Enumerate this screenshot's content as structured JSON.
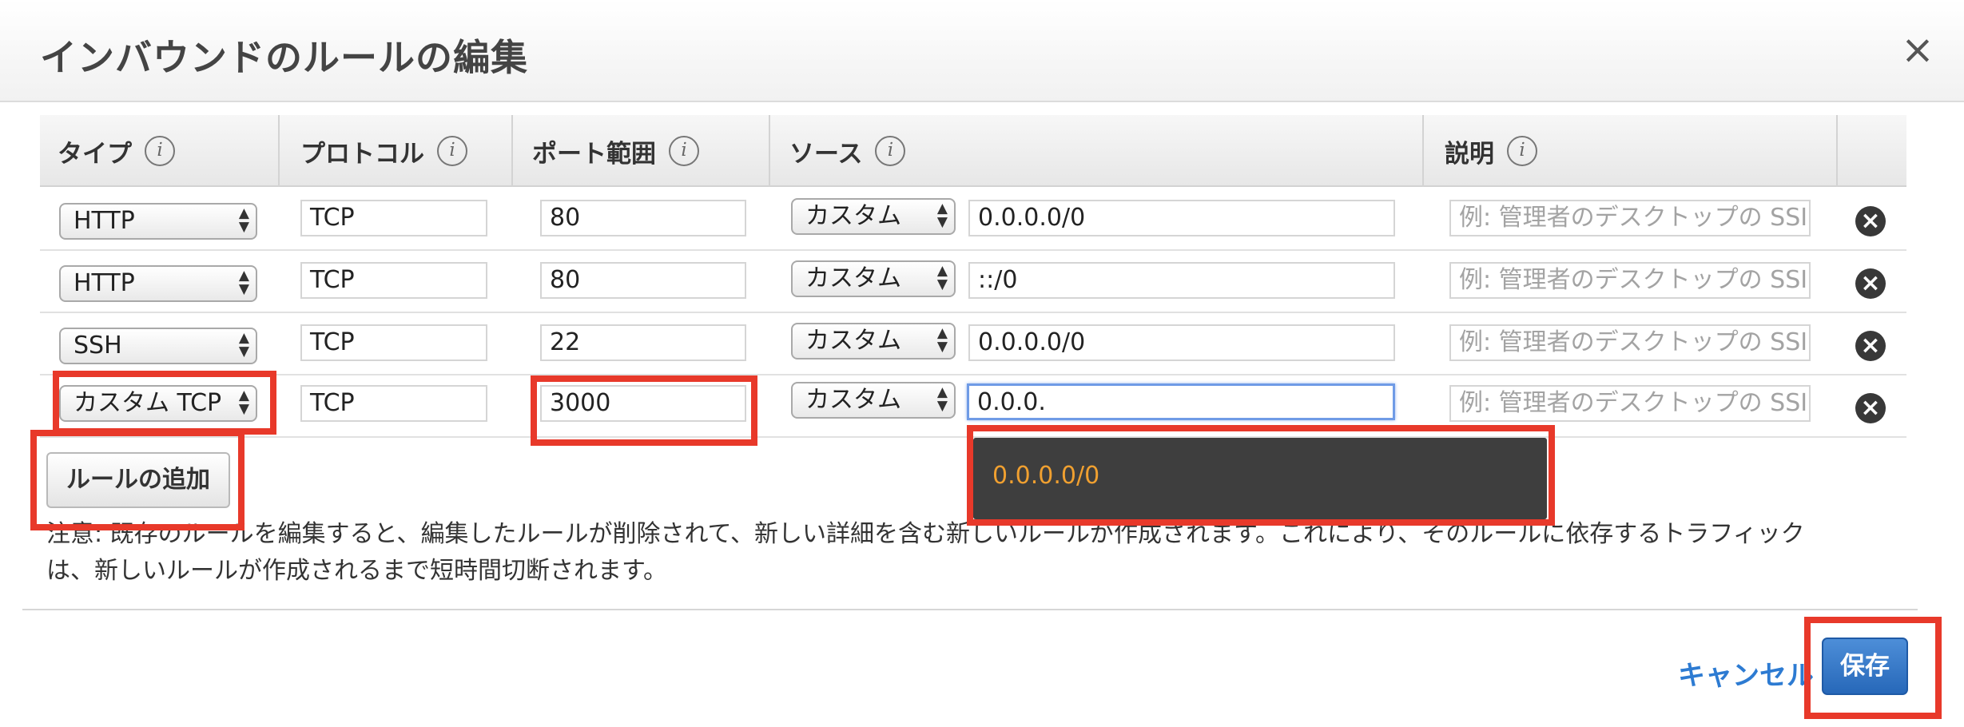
{
  "dialog": {
    "title": "インバウンドのルールの編集",
    "close": "×"
  },
  "table": {
    "headers": {
      "type": "タイプ",
      "protocol": "プロトコル",
      "port_range": "ポート範囲",
      "source": "ソース",
      "description": "説明"
    },
    "info_glyph": "i",
    "rows": [
      {
        "type": "HTTP",
        "protocol": "TCP",
        "port": "80",
        "source_type": "カスタム",
        "source": "0.0.0.0/0",
        "description_placeholder": "例: 管理者のデスクトップの SSI"
      },
      {
        "type": "HTTP",
        "protocol": "TCP",
        "port": "80",
        "source_type": "カスタム",
        "source": "::/0",
        "description_placeholder": "例: 管理者のデスクトップの SSI"
      },
      {
        "type": "SSH",
        "protocol": "TCP",
        "port": "22",
        "source_type": "カスタム",
        "source": "0.0.0.0/0",
        "description_placeholder": "例: 管理者のデスクトップの SSI"
      },
      {
        "type": "カスタム TCP",
        "protocol": "TCP",
        "port": "3000",
        "source_type": "カスタム",
        "source": "0.0.0.",
        "description_placeholder": "例: 管理者のデスクトップの SSI"
      }
    ],
    "remove_glyph": "×"
  },
  "add_rule_label": "ルールの追加",
  "autocomplete": {
    "suggestion": "0.0.0.0/0"
  },
  "note": "注意: 既存のルールを編集すると、編集したルールが削除されて、新しい詳細を含む新しいルールが作成されます。これにより、そのルールに依存するトラフィックは、新しいルールが作成されるまで短時間切断されます。",
  "footer": {
    "cancel_label": "キャンセル",
    "save_label": "保存"
  },
  "colors": {
    "highlight": "#e8392a",
    "primary_button": "#2d6fc0",
    "link": "#2d7bd2",
    "suggestion_text": "#f0a030"
  }
}
